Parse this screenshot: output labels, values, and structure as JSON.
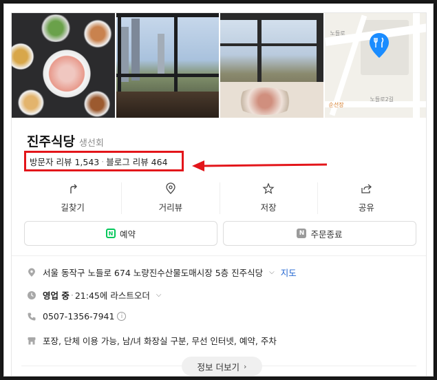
{
  "place": {
    "name": "진주식당",
    "category": "생선회",
    "visitor_review_label": "방문자 리뷰 1,543",
    "blog_review_label": "블로그 리뷰 464"
  },
  "map": {
    "road_label_1": "노들로",
    "road_label_2": "노들로2길",
    "poi_label": "순선장"
  },
  "actions": [
    {
      "label": "길찾기",
      "icon": "directions-icon"
    },
    {
      "label": "거리뷰",
      "icon": "location-pin-icon"
    },
    {
      "label": "저장",
      "icon": "star-icon"
    },
    {
      "label": "공유",
      "icon": "share-icon"
    }
  ],
  "buttons": {
    "reserve": "예약",
    "order_status": "주문종료"
  },
  "info": {
    "address": "서울 동작구 노들로 674 노량진수산물도매시장 5층 진주식당",
    "map_link": "지도",
    "hours_status": "영업 중",
    "hours_detail": "21:45에 라스트오더",
    "phone": "0507-1356-7941",
    "amenities": "포장, 단체 이용 가능, 남/녀 화장실 구분, 무선 인터넷, 예약, 주차"
  },
  "more_button": "정보 더보기",
  "colors": {
    "highlight": "#e3151a",
    "link": "#2065d1",
    "naver_green": "#03c75a",
    "pin_blue": "#1a8cff"
  }
}
